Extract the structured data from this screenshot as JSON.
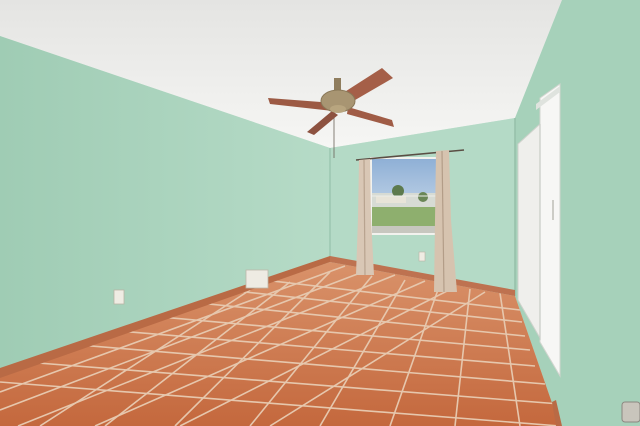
{
  "image": {
    "subject": "empty-bedroom-interior"
  },
  "colors": {
    "ceiling": "#f1f1ef",
    "wall_left": "#a9d4bd",
    "wall_back": "#b4dac6",
    "wall_right": "#a2cfb7",
    "floor_tile": "#c86e43",
    "grout": "#e9cdb4",
    "baseboard": "#b96a45",
    "door": "#f3f3f1",
    "fan_blade": "#a5624c",
    "fan_body": "#a89572",
    "curtain": "#d8c6b4",
    "sky": "#a9c4df",
    "lawn": "#8eaf6e"
  }
}
